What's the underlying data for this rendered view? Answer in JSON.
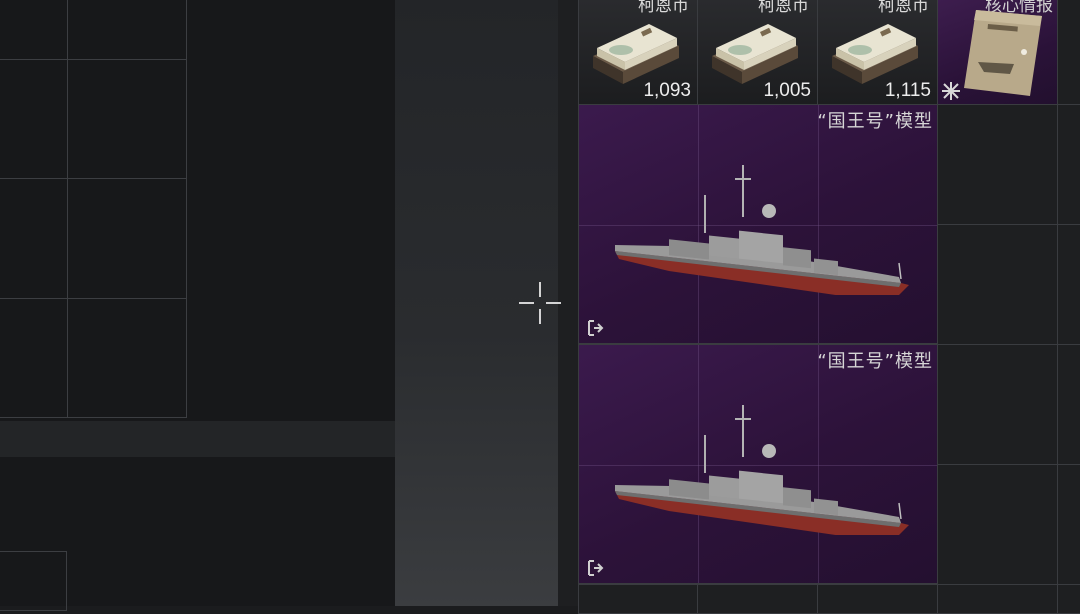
{
  "inventory": {
    "money_items": [
      {
        "name": "柯恩币",
        "count": "1,093",
        "icon": "money-stack-icon"
      },
      {
        "name": "柯恩币",
        "count": "1,005",
        "icon": "money-stack-icon"
      },
      {
        "name": "柯恩币",
        "count": "1,115",
        "icon": "money-stack-icon"
      }
    ],
    "intel_item": {
      "name": "核心情报",
      "icon": "intel-document-icon",
      "rarity_color": "#3a1a4c"
    },
    "models": [
      {
        "name": "“国王号”模型",
        "icon": "ship-model-icon"
      },
      {
        "name": "“国王号”模型",
        "icon": "ship-model-icon"
      }
    ]
  },
  "colors": {
    "rare_purple": "#3b1a4d",
    "background": "#1b1c1e",
    "grid_line": "#3a3c40"
  }
}
